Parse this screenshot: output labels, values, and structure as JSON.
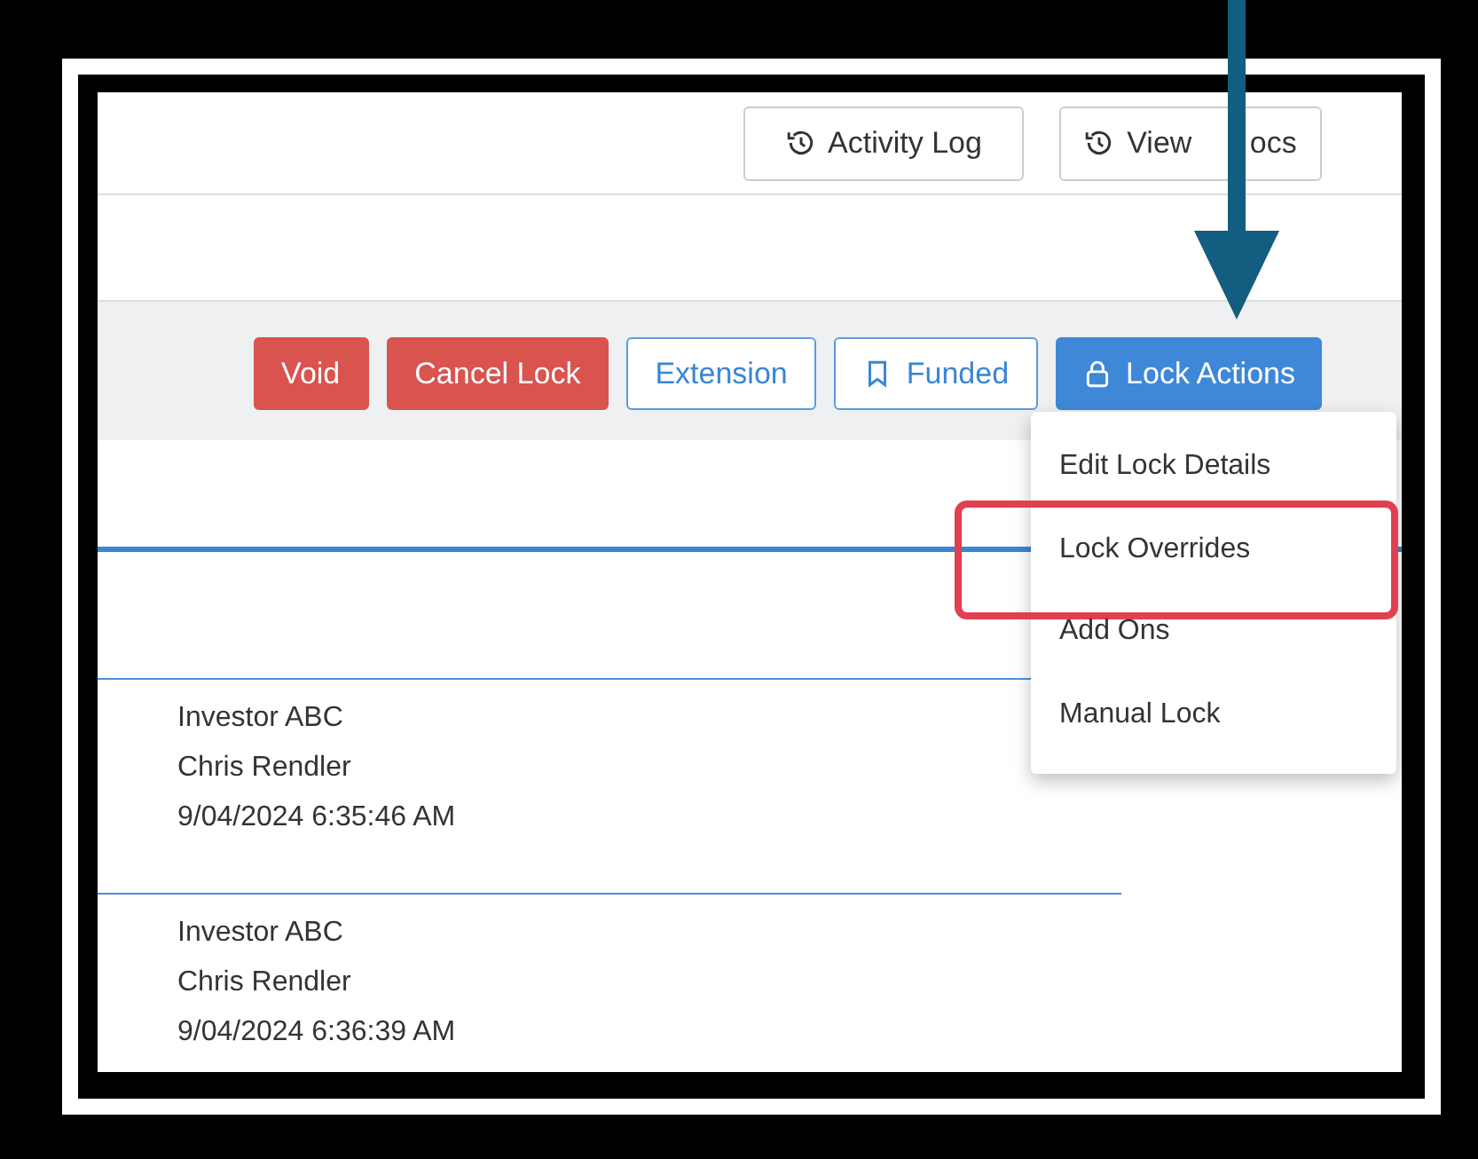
{
  "header_buttons": [
    {
      "label": "Activity Log"
    },
    {
      "label": "View ocs"
    }
  ],
  "action_buttons": [
    {
      "label": "Void",
      "kind": "danger"
    },
    {
      "label": "Cancel Lock",
      "kind": "danger"
    },
    {
      "label": "Extension",
      "kind": "outline"
    },
    {
      "label": "Funded",
      "kind": "bookmark"
    },
    {
      "label": "Lock Actions",
      "kind": "lock"
    }
  ],
  "lock_actions_menu": [
    {
      "label": "Edit Lock Details",
      "highlighted": false
    },
    {
      "label": "Lock Overrides",
      "highlighted": true
    },
    {
      "label": "Add Ons",
      "highlighted": false
    },
    {
      "label": "Manual Lock",
      "highlighted": false
    }
  ],
  "entries": [
    {
      "investor": "Investor ABC",
      "user": "Chris Rendler",
      "timestamp": "9/04/2024 6:35:46 AM"
    },
    {
      "investor": "Investor ABC",
      "user": "Chris Rendler",
      "timestamp": "9/04/2024 6:36:39 AM"
    }
  ]
}
